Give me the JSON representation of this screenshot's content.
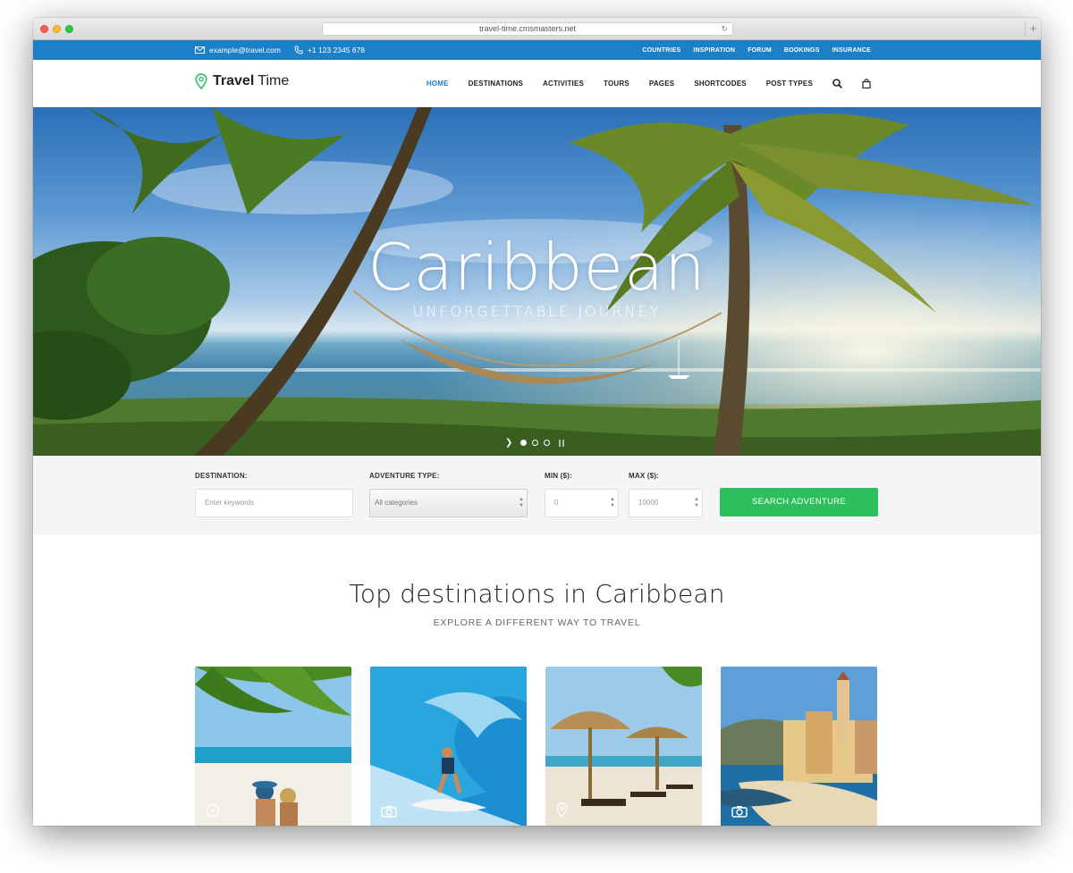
{
  "browser": {
    "url": "travel-time.cmsmasters.net"
  },
  "topbar": {
    "email": "example@travel.com",
    "phone": "+1 123 2345 678",
    "links": [
      "COUNTRIES",
      "INSPIRATION",
      "FORUM",
      "BOOKINGS",
      "INSURANCE"
    ]
  },
  "header": {
    "logo_bold": "Travel",
    "logo_light": "Time",
    "nav": [
      "HOME",
      "DESTINATIONS",
      "ACTIVITIES",
      "TOURS",
      "PAGES",
      "SHORTCODES",
      "POST TYPES"
    ],
    "active_nav": "HOME"
  },
  "hero": {
    "title": "Caribbean",
    "subtitle": "UNFORGETTABLE JOURNEY",
    "slides": 3,
    "active_slide": 1
  },
  "search": {
    "destination_label": "DESTINATION:",
    "destination_placeholder": "Enter keywords",
    "type_label": "ADVENTURE TYPE:",
    "type_value": "All categories",
    "min_label": "MIN ($):",
    "min_value": "0",
    "max_label": "MAX ($):",
    "max_value": "10000",
    "button": "SEARCH ADVENTURE"
  },
  "section": {
    "title": "Top destinations in Caribbean",
    "subtitle": "EXPLORE A DIFFERENT WAY TO TRAVEL"
  },
  "cards": [
    {
      "icon": "compass-icon"
    },
    {
      "icon": "camera-icon"
    },
    {
      "icon": "map-pin-icon"
    },
    {
      "icon": "camera-icon"
    }
  ],
  "colors": {
    "brand_blue": "#1b80c8",
    "search_green": "#2dbf5c",
    "logo_green": "#2dbf5c"
  }
}
